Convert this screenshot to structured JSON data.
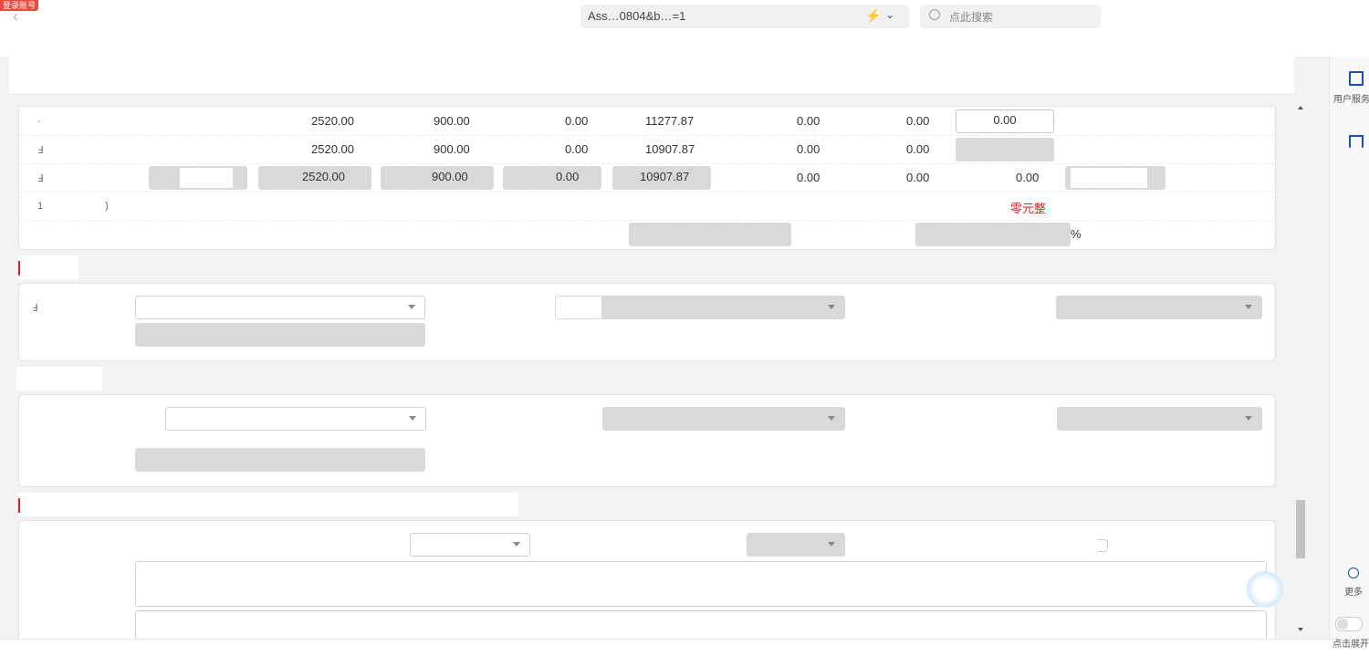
{
  "browser": {
    "badge": "登录账号",
    "url": "Ass…0804&b…=1",
    "search_placeholder": "点此搜索"
  },
  "amount_table": {
    "rows": [
      {
        "c1": "2520.00",
        "c2": "900.00",
        "c3": "0.00",
        "c4": "11277.87",
        "c5": "0.00",
        "c6": "0.00",
        "c7": "0.00"
      },
      {
        "c1": "2520.00",
        "c2": "900.00",
        "c3": "0.00",
        "c4": "10907.87",
        "c5": "0.00",
        "c6": "0.00"
      },
      {
        "c1": "2520.00",
        "c2": "900.00",
        "c3": "0.00",
        "c4": "10907.87",
        "c5": "0.00",
        "c6": "0.00",
        "c7": "0.00"
      }
    ],
    "amount_in_words": "零元整",
    "percent_unit": "%"
  },
  "right_panel": {
    "user_service": "用户服务",
    "more": "更多",
    "expand": "点击展开"
  }
}
